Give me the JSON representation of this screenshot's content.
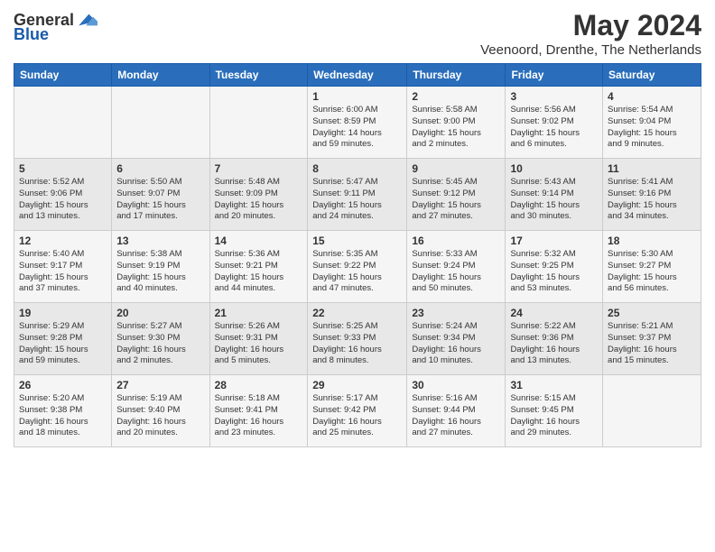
{
  "logo": {
    "general": "General",
    "blue": "Blue"
  },
  "title": "May 2024",
  "subtitle": "Veenoord, Drenthe, The Netherlands",
  "weekdays": [
    "Sunday",
    "Monday",
    "Tuesday",
    "Wednesday",
    "Thursday",
    "Friday",
    "Saturday"
  ],
  "weeks": [
    [
      {
        "day": "",
        "info": ""
      },
      {
        "day": "",
        "info": ""
      },
      {
        "day": "",
        "info": ""
      },
      {
        "day": "1",
        "info": "Sunrise: 6:00 AM\nSunset: 8:59 PM\nDaylight: 14 hours\nand 59 minutes."
      },
      {
        "day": "2",
        "info": "Sunrise: 5:58 AM\nSunset: 9:00 PM\nDaylight: 15 hours\nand 2 minutes."
      },
      {
        "day": "3",
        "info": "Sunrise: 5:56 AM\nSunset: 9:02 PM\nDaylight: 15 hours\nand 6 minutes."
      },
      {
        "day": "4",
        "info": "Sunrise: 5:54 AM\nSunset: 9:04 PM\nDaylight: 15 hours\nand 9 minutes."
      }
    ],
    [
      {
        "day": "5",
        "info": "Sunrise: 5:52 AM\nSunset: 9:06 PM\nDaylight: 15 hours\nand 13 minutes."
      },
      {
        "day": "6",
        "info": "Sunrise: 5:50 AM\nSunset: 9:07 PM\nDaylight: 15 hours\nand 17 minutes."
      },
      {
        "day": "7",
        "info": "Sunrise: 5:48 AM\nSunset: 9:09 PM\nDaylight: 15 hours\nand 20 minutes."
      },
      {
        "day": "8",
        "info": "Sunrise: 5:47 AM\nSunset: 9:11 PM\nDaylight: 15 hours\nand 24 minutes."
      },
      {
        "day": "9",
        "info": "Sunrise: 5:45 AM\nSunset: 9:12 PM\nDaylight: 15 hours\nand 27 minutes."
      },
      {
        "day": "10",
        "info": "Sunrise: 5:43 AM\nSunset: 9:14 PM\nDaylight: 15 hours\nand 30 minutes."
      },
      {
        "day": "11",
        "info": "Sunrise: 5:41 AM\nSunset: 9:16 PM\nDaylight: 15 hours\nand 34 minutes."
      }
    ],
    [
      {
        "day": "12",
        "info": "Sunrise: 5:40 AM\nSunset: 9:17 PM\nDaylight: 15 hours\nand 37 minutes."
      },
      {
        "day": "13",
        "info": "Sunrise: 5:38 AM\nSunset: 9:19 PM\nDaylight: 15 hours\nand 40 minutes."
      },
      {
        "day": "14",
        "info": "Sunrise: 5:36 AM\nSunset: 9:21 PM\nDaylight: 15 hours\nand 44 minutes."
      },
      {
        "day": "15",
        "info": "Sunrise: 5:35 AM\nSunset: 9:22 PM\nDaylight: 15 hours\nand 47 minutes."
      },
      {
        "day": "16",
        "info": "Sunrise: 5:33 AM\nSunset: 9:24 PM\nDaylight: 15 hours\nand 50 minutes."
      },
      {
        "day": "17",
        "info": "Sunrise: 5:32 AM\nSunset: 9:25 PM\nDaylight: 15 hours\nand 53 minutes."
      },
      {
        "day": "18",
        "info": "Sunrise: 5:30 AM\nSunset: 9:27 PM\nDaylight: 15 hours\nand 56 minutes."
      }
    ],
    [
      {
        "day": "19",
        "info": "Sunrise: 5:29 AM\nSunset: 9:28 PM\nDaylight: 15 hours\nand 59 minutes."
      },
      {
        "day": "20",
        "info": "Sunrise: 5:27 AM\nSunset: 9:30 PM\nDaylight: 16 hours\nand 2 minutes."
      },
      {
        "day": "21",
        "info": "Sunrise: 5:26 AM\nSunset: 9:31 PM\nDaylight: 16 hours\nand 5 minutes."
      },
      {
        "day": "22",
        "info": "Sunrise: 5:25 AM\nSunset: 9:33 PM\nDaylight: 16 hours\nand 8 minutes."
      },
      {
        "day": "23",
        "info": "Sunrise: 5:24 AM\nSunset: 9:34 PM\nDaylight: 16 hours\nand 10 minutes."
      },
      {
        "day": "24",
        "info": "Sunrise: 5:22 AM\nSunset: 9:36 PM\nDaylight: 16 hours\nand 13 minutes."
      },
      {
        "day": "25",
        "info": "Sunrise: 5:21 AM\nSunset: 9:37 PM\nDaylight: 16 hours\nand 15 minutes."
      }
    ],
    [
      {
        "day": "26",
        "info": "Sunrise: 5:20 AM\nSunset: 9:38 PM\nDaylight: 16 hours\nand 18 minutes."
      },
      {
        "day": "27",
        "info": "Sunrise: 5:19 AM\nSunset: 9:40 PM\nDaylight: 16 hours\nand 20 minutes."
      },
      {
        "day": "28",
        "info": "Sunrise: 5:18 AM\nSunset: 9:41 PM\nDaylight: 16 hours\nand 23 minutes."
      },
      {
        "day": "29",
        "info": "Sunrise: 5:17 AM\nSunset: 9:42 PM\nDaylight: 16 hours\nand 25 minutes."
      },
      {
        "day": "30",
        "info": "Sunrise: 5:16 AM\nSunset: 9:44 PM\nDaylight: 16 hours\nand 27 minutes."
      },
      {
        "day": "31",
        "info": "Sunrise: 5:15 AM\nSunset: 9:45 PM\nDaylight: 16 hours\nand 29 minutes."
      },
      {
        "day": "",
        "info": ""
      }
    ]
  ]
}
